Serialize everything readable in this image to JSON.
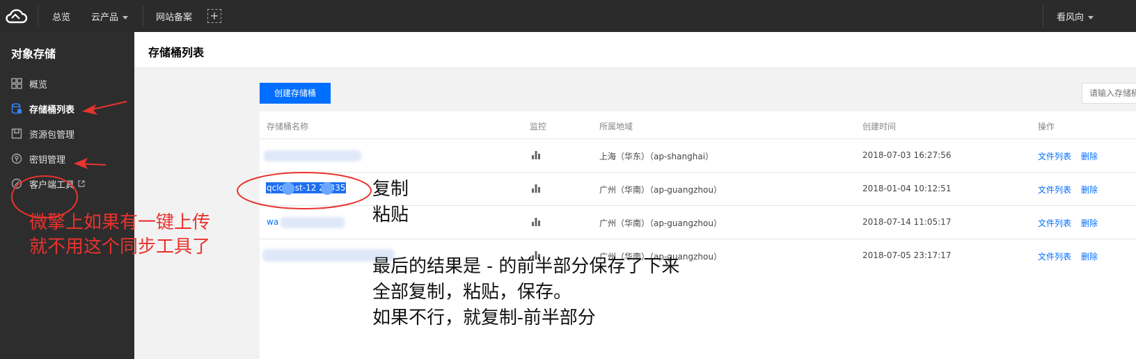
{
  "topbar": {
    "nav_overview": "总览",
    "nav_products": "云产品",
    "nav_icp": "网站备案",
    "user": "看风向"
  },
  "sidebar": {
    "title": "对象存储",
    "items": [
      {
        "label": "概览"
      },
      {
        "label": "存储桶列表"
      },
      {
        "label": "资源包管理"
      },
      {
        "label": "密钥管理"
      },
      {
        "label": "客户端工具"
      }
    ]
  },
  "header": {
    "title": "存储桶列表"
  },
  "toolbar": {
    "create_label": "创建存储桶",
    "search_placeholder": "请输入存储桶"
  },
  "table": {
    "columns": [
      "存储桶名称",
      "监控",
      "所属地域",
      "创建时间",
      "操作"
    ],
    "rows": [
      {
        "name": "",
        "region": "上海（华东）（ap-shanghai）",
        "created": "2018-07-03 16:27:56",
        "action1": "文件列表",
        "action2": "删除"
      },
      {
        "name": "qclo   test-12   28335",
        "region": "广州（华南）（ap-guangzhou）",
        "created": "2018-01-04 10:12:51",
        "action1": "文件列表",
        "action2": "删除"
      },
      {
        "name": "wa",
        "region": "广州（华南）（ap-guangzhou）",
        "created": "2018-07-14 11:05:17",
        "action1": "文件列表",
        "action2": "删除"
      },
      {
        "name": "",
        "region": "广州（华南）（ap-guangzhou）",
        "created": "2018-07-05 23:17:17",
        "action1": "文件列表",
        "action2": "删除"
      }
    ]
  },
  "annotations": {
    "red_line1": "微擎上如果有一键上传",
    "red_line2": "就不用这个同步工具了",
    "copy": "复制",
    "paste": "粘贴",
    "note_line1": "最后的结果是 - 的前半部分保存了下来",
    "note_line2": "全部复制，粘贴，保存。",
    "note_line3": "如果不行，就复制-前半部分"
  },
  "colors": {
    "accent": "#006eff",
    "annotation_red": "#e8332e",
    "topbar_bg": "#2b2b2b",
    "sidebar_bg": "#2d2d2d"
  }
}
